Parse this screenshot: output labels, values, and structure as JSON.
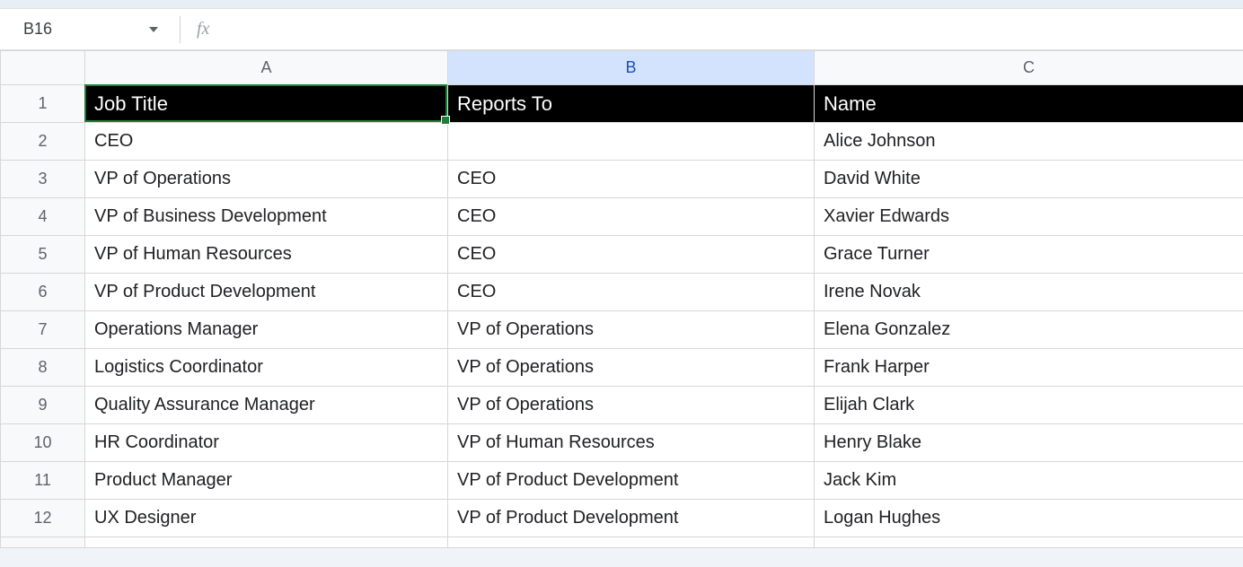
{
  "nameBox": {
    "cellRef": "B16"
  },
  "formulaBar": {
    "value": ""
  },
  "columns": [
    "A",
    "B",
    "C"
  ],
  "selectedColumn": "B",
  "currentCell": "A1",
  "headerRow": {
    "A": "Job Title",
    "B": "Reports To",
    "C": "Name"
  },
  "rows": [
    {
      "n": "2",
      "A": "CEO",
      "B": "",
      "C": "Alice Johnson"
    },
    {
      "n": "3",
      "A": "VP of Operations",
      "B": "CEO",
      "C": "David White"
    },
    {
      "n": "4",
      "A": "VP of Business Development",
      "B": "CEO",
      "C": "Xavier Edwards"
    },
    {
      "n": "5",
      "A": "VP of Human Resources",
      "B": "CEO",
      "C": "Grace Turner"
    },
    {
      "n": "6",
      "A": "VP of Product Development",
      "B": "CEO",
      "C": "Irene Novak"
    },
    {
      "n": "7",
      "A": "Operations Manager",
      "B": "VP of Operations",
      "C": "Elena Gonzalez"
    },
    {
      "n": "8",
      "A": "Logistics Coordinator",
      "B": "VP of Operations",
      "C": "Frank Harper"
    },
    {
      "n": "9",
      "A": "Quality Assurance Manager",
      "B": "VP of Operations",
      "C": "Elijah Clark"
    },
    {
      "n": "10",
      "A": "HR Coordinator",
      "B": "VP of Human Resources",
      "C": "Henry Blake"
    },
    {
      "n": "11",
      "A": "Product Manager",
      "B": "VP of Product Development",
      "C": "Jack Kim"
    },
    {
      "n": "12",
      "A": "UX Designer",
      "B": "VP of Product Development",
      "C": "Logan Hughes"
    }
  ]
}
